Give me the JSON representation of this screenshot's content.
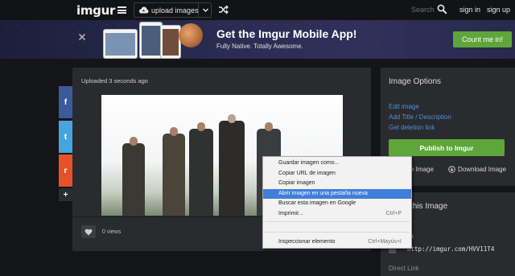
{
  "nav": {
    "logo": "imgur",
    "upload_label": "upload images",
    "search_placeholder": "Search",
    "signin": "sign in",
    "signup": "sign up"
  },
  "banner": {
    "title": "Get the Imgur Mobile App!",
    "subtitle": "Fully Native. Totally Awesome.",
    "cta": "Count me in!"
  },
  "post": {
    "uploaded": "Uploaded 3 seconds ago",
    "views": "0 views"
  },
  "share": {
    "facebook": "f",
    "twitter": "t",
    "reddit": "r",
    "more": "+"
  },
  "sidebar": {
    "title": "Image Options",
    "links": [
      "Edit image",
      "Add Title / Description",
      "Get deletion link"
    ],
    "publish": "Publish to Imgur",
    "embed": "e Image",
    "download": "Download Image"
  },
  "share_panel": {
    "title": "this Image",
    "label": "k",
    "url": "http://imgur.com/HVV11T4",
    "direct": "Direct Link"
  },
  "context_menu": {
    "items": [
      {
        "label": "Guardar imagen como...",
        "shortcut": ""
      },
      {
        "label": "Copiar URL de imagen",
        "shortcut": ""
      },
      {
        "label": "Copiar imagen",
        "shortcut": ""
      },
      {
        "label": "Abrir imagen en una pestaña nueva",
        "shortcut": "",
        "active": true
      },
      {
        "label": "Buscar esta imagen en Google",
        "shortcut": ""
      },
      {
        "label": "Imprimir...",
        "shortcut": "Ctrl+P"
      },
      {
        "label": "Inspeccionar elemento",
        "shortcut": "Ctrl+Mayús+I"
      }
    ]
  },
  "colors": {
    "accent_green": "#5ea63a",
    "link_blue": "#4f8fd6",
    "menu_highlight": "#3f7fd9"
  }
}
